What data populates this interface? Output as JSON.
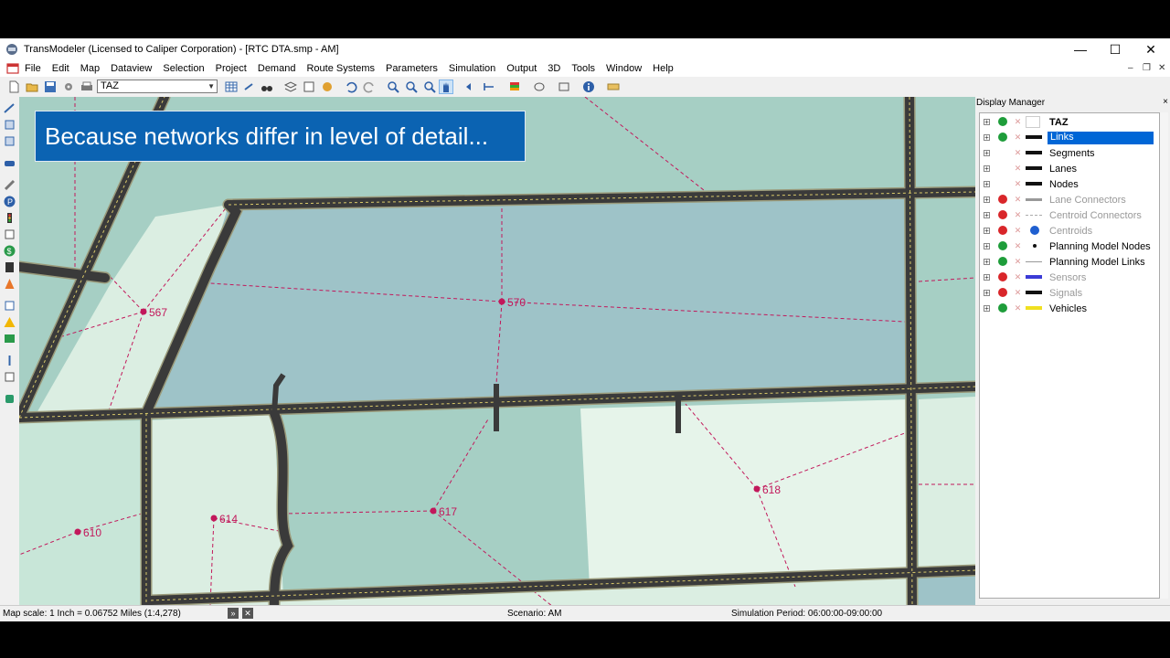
{
  "window": {
    "title": "TransModeler (Licensed to Caliper Corporation) - [RTC DTA.smp - AM]",
    "minimize": "—",
    "maximize": "☐",
    "close": "✕"
  },
  "menu": {
    "items": [
      "File",
      "Edit",
      "Map",
      "Dataview",
      "Selection",
      "Project",
      "Demand",
      "Route Systems",
      "Parameters",
      "Simulation",
      "Output",
      "3D",
      "Tools",
      "Window",
      "Help"
    ],
    "mdi_minimize": "–",
    "mdi_restore": "❐",
    "mdi_close": "✕"
  },
  "toolbar": {
    "layer_combo_value": "TAZ"
  },
  "banner": {
    "text": "Because networks differ in level of detail..."
  },
  "map": {
    "zone_labels": [
      {
        "id": "567",
        "label": "567"
      },
      {
        "id": "570",
        "label": "570"
      },
      {
        "id": "610",
        "label": "610"
      },
      {
        "id": "614",
        "label": "614"
      },
      {
        "id": "617",
        "label": "617"
      },
      {
        "id": "618",
        "label": "618"
      }
    ],
    "colors": {
      "zone_blue": "#9ec3c8",
      "zone_light": "#dbeee2",
      "zone_mint": "#c8e6d8",
      "road": "#3a3a3a",
      "road_edge": "#9a9a7a",
      "connector": "#c2185b"
    }
  },
  "display_manager": {
    "title": "Display Manager",
    "close": "×",
    "layers": [
      {
        "name": "TAZ",
        "visible": true,
        "symbol": "box",
        "bold": true
      },
      {
        "name": "Links",
        "visible": true,
        "symbol": "thick",
        "selected": true
      },
      {
        "name": "Segments",
        "visible": null,
        "symbol": "thick"
      },
      {
        "name": "Lanes",
        "visible": null,
        "symbol": "thick"
      },
      {
        "name": "Nodes",
        "visible": null,
        "symbol": "thick"
      },
      {
        "name": "Lane Connectors",
        "visible": false,
        "symbol": "gray",
        "dimmed": true
      },
      {
        "name": "Centroid Connectors",
        "visible": false,
        "symbol": "dashed",
        "dimmed": true
      },
      {
        "name": "Centroids",
        "visible": false,
        "symbol": "dot-blue",
        "dimmed": true
      },
      {
        "name": "Planning Model Nodes",
        "visible": true,
        "symbol": "dot"
      },
      {
        "name": "Planning Model Links",
        "visible": true,
        "symbol": "thin"
      },
      {
        "name": "Sensors",
        "visible": false,
        "symbol": "blue",
        "dimmed": true
      },
      {
        "name": "Signals",
        "visible": false,
        "symbol": "thick",
        "dimmed": true
      },
      {
        "name": "Vehicles",
        "visible": true,
        "symbol": "yellow"
      }
    ]
  },
  "statusbar": {
    "scale": "Map scale: 1 Inch = 0.06752 Miles (1:4,278)",
    "scenario": "Scenario: AM",
    "period": "Simulation Period: 06:00:00-09:00:00"
  }
}
